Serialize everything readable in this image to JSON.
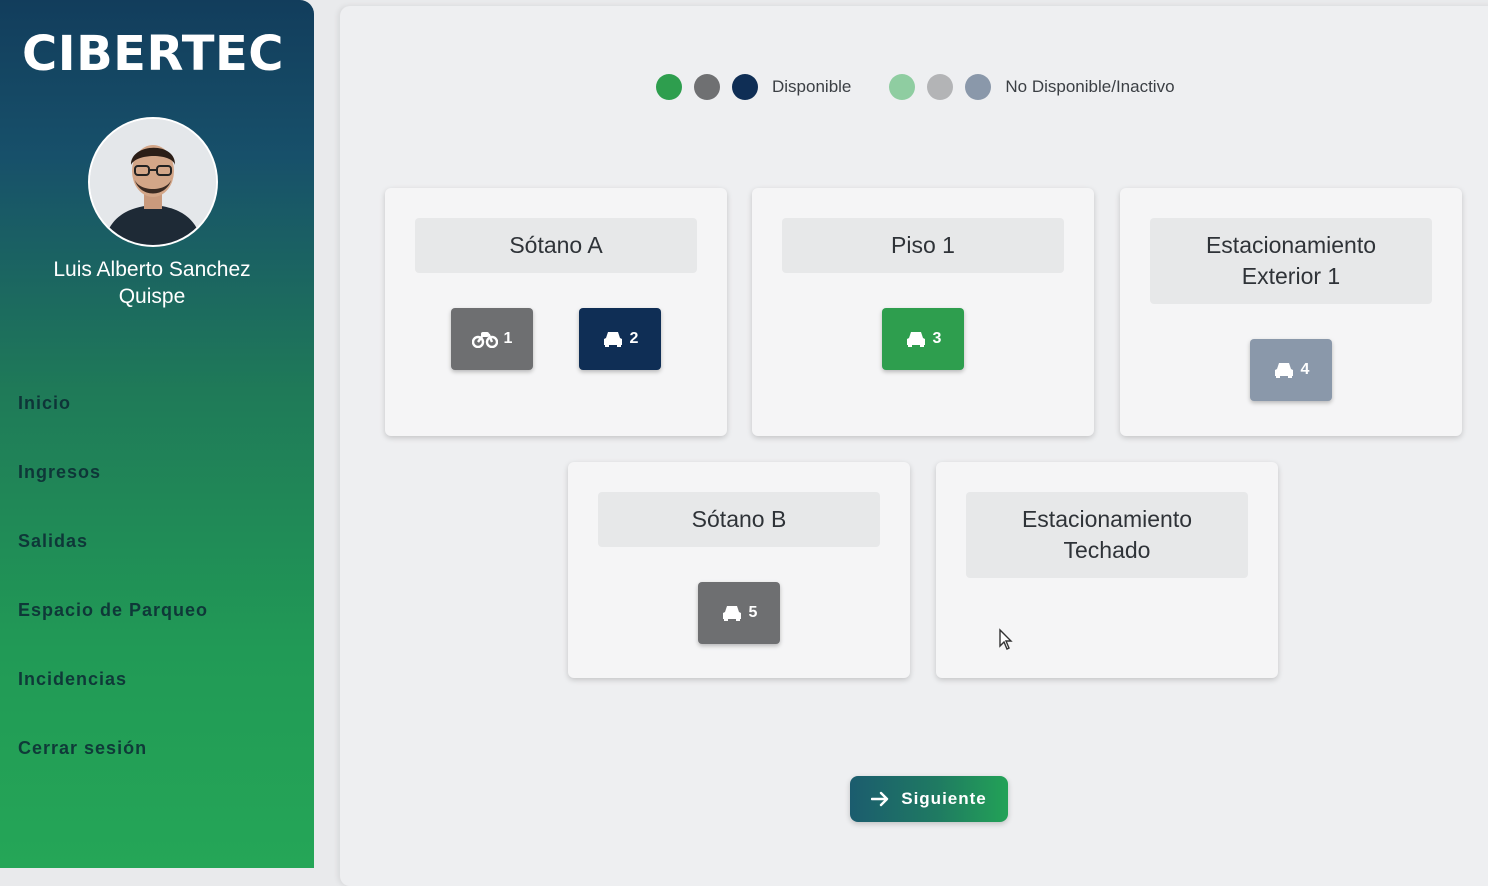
{
  "sidebar": {
    "brand": "CIBERTEC",
    "user_name_line1": "Luis Alberto Sanchez",
    "user_name_line2": "Quispe",
    "nav": [
      {
        "label": "Inicio"
      },
      {
        "label": "Ingresos"
      },
      {
        "label": "Salidas"
      },
      {
        "label": "Espacio de Parqueo"
      },
      {
        "label": "Incidencias"
      },
      {
        "label": "Cerrar sesión"
      }
    ]
  },
  "legend": {
    "available_label": "Disponible",
    "unavailable_label": "No Disponible/Inactivo",
    "available_colors": [
      "#2e9e4e",
      "#6f7072",
      "#0f2e55"
    ],
    "unavailable_colors": [
      "#8fcda1",
      "#b3b4b6",
      "#8a98aa"
    ]
  },
  "zones": [
    {
      "name": "Sótano A",
      "slots": [
        {
          "number": "1",
          "icon": "motorcycle-icon",
          "color": "#6e6f71"
        },
        {
          "number": "2",
          "icon": "car-icon",
          "color": "#0f2e55"
        }
      ]
    },
    {
      "name": "Piso 1",
      "slots": [
        {
          "number": "3",
          "icon": "car-icon",
          "color": "#2e9e4e"
        }
      ]
    },
    {
      "name_line1": "Estacionamiento",
      "name_line2": "Exterior 1",
      "slots": [
        {
          "number": "4",
          "icon": "car-icon",
          "color": "#8a98aa"
        }
      ]
    },
    {
      "name": "Sótano B",
      "slots": [
        {
          "number": "5",
          "icon": "car-icon",
          "color": "#6e6f71"
        }
      ]
    },
    {
      "name_line1": "Estacionamiento",
      "name_line2": "Techado",
      "slots": []
    }
  ],
  "actions": {
    "next_label": "Siguiente",
    "next_icon": "arrow-right-icon"
  }
}
